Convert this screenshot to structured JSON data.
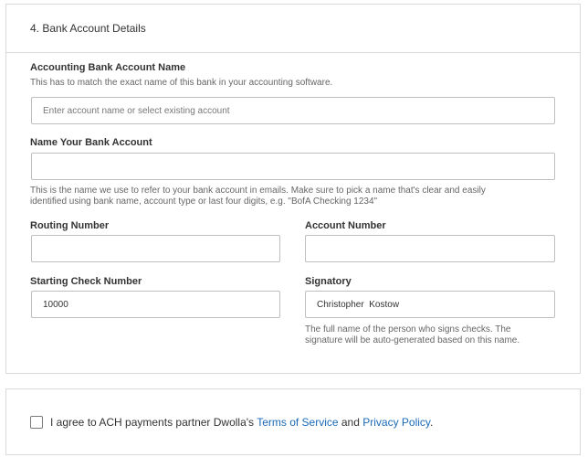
{
  "section": {
    "title": "4. Bank Account Details"
  },
  "accounting_bank": {
    "label": "Accounting Bank Account Name",
    "help": "This has to match the exact name of this bank in your accounting software.",
    "placeholder": "Enter account name or select existing account",
    "value": ""
  },
  "nickname": {
    "label": "Name Your Bank Account",
    "value": "",
    "help_line1": "This is the name we use to refer to your bank account in emails. Make sure to pick a name that's clear and easily",
    "help_line2": "identified using bank name, account type or last four digits, e.g. \"BofA Checking 1234\""
  },
  "routing": {
    "label": "Routing Number",
    "value": ""
  },
  "account_number": {
    "label": "Account Number",
    "value": ""
  },
  "starting_check": {
    "label": "Starting Check Number",
    "value": "10000"
  },
  "signatory": {
    "label": "Signatory",
    "value": "Christopher  Kostow",
    "help_line1": "The full name of the person who signs checks. The",
    "help_line2": "signature will be auto-generated based on this name."
  },
  "terms": {
    "checked": false,
    "prefix": "I agree to ACH payments partner Dwolla's ",
    "tos_link": "Terms of Service",
    "middle": " and ",
    "privacy_link": "Privacy Policy",
    "suffix": "."
  },
  "colors": {
    "link": "#1a6ab8",
    "border": "#d9d9d9",
    "input_border": "#bfbfbf"
  }
}
